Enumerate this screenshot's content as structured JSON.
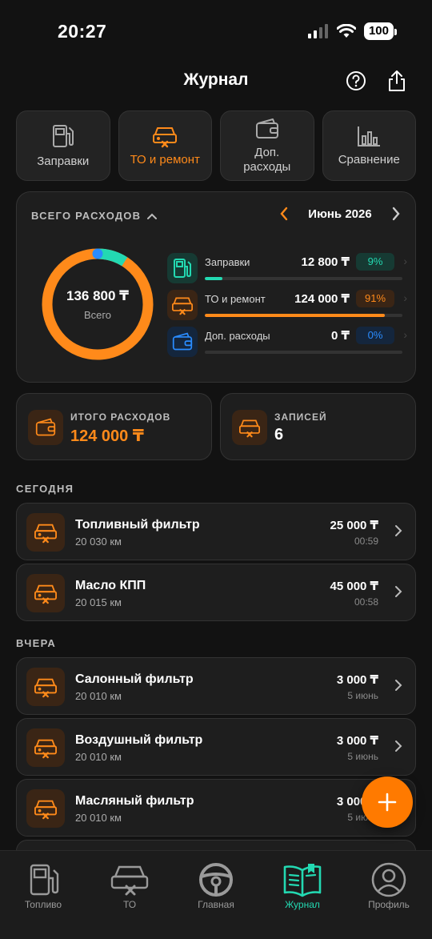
{
  "status_bar": {
    "time": "20:27",
    "battery": "100"
  },
  "header": {
    "title": "Журнал"
  },
  "tabs": [
    {
      "label": "Заправки",
      "icon": "fuel-pump-icon",
      "active": false
    },
    {
      "label": "ТО и ремонт",
      "icon": "car-repair-icon",
      "active": true
    },
    {
      "label": "Доп. расходы",
      "icon": "wallet-icon",
      "active": false
    },
    {
      "label": "Сравнение",
      "icon": "bar-chart-icon",
      "active": false
    }
  ],
  "summary": {
    "heading": "ВСЕГО РАСХОДОВ",
    "month": "Июнь 2026",
    "total": "136 800 ₸",
    "total_label": "Всего",
    "categories": [
      {
        "name": "Заправки",
        "amount": "12 800 ₸",
        "percent": "9%",
        "share": 0.09,
        "color": "#23d9b2",
        "icon": "fuel-pump-icon"
      },
      {
        "name": "ТО и ремонт",
        "amount": "124 000 ₸",
        "percent": "91%",
        "share": 0.91,
        "color": "#ff8a1a",
        "icon": "car-repair-icon"
      },
      {
        "name": "Доп. расходы",
        "amount": "0 ₸",
        "percent": "0%",
        "share": 0.0,
        "color": "#2a8cff",
        "icon": "wallet-icon"
      }
    ]
  },
  "stats": {
    "total_label": "ИТОГО РАСХОДОВ",
    "total_value": "124 000 ₸",
    "records_label": "ЗАПИСЕЙ",
    "records_value": "6"
  },
  "sections": {
    "today": "СЕГОДНЯ",
    "yesterday": "ВЧЕРА"
  },
  "entries": [
    {
      "title": "Топливный фильтр",
      "km": "20 030 км",
      "amount": "25 000 ₸",
      "time": "00:59"
    },
    {
      "title": "Масло КПП",
      "km": "20 015 км",
      "amount": "45 000 ₸",
      "time": "00:58"
    },
    {
      "title": "Салонный фильтр",
      "km": "20 010 км",
      "amount": "3 000 ₸",
      "time": "5 июнь"
    },
    {
      "title": "Воздушный фильтр",
      "km": "20 010 км",
      "amount": "3 000 ₸",
      "time": "5 июнь"
    },
    {
      "title": "Масляный фильтр",
      "km": "20 010 км",
      "amount": "3 000 ₸",
      "time": "5 июнь"
    }
  ],
  "nav": [
    {
      "label": "Топливо",
      "icon": "fuel-pump-icon",
      "active": false
    },
    {
      "label": "ТО",
      "icon": "car-repair-icon",
      "active": false
    },
    {
      "label": "Главная",
      "icon": "steering-wheel-icon",
      "active": false
    },
    {
      "label": "Журнал",
      "icon": "journal-book-icon",
      "active": true
    },
    {
      "label": "Профиль",
      "icon": "profile-icon",
      "active": false
    }
  ],
  "colors": {
    "accent": "#ff8a1a",
    "fuel": "#23d9b2",
    "extra": "#2a8cff",
    "background": "#121212",
    "card": "#1e1e1e"
  }
}
